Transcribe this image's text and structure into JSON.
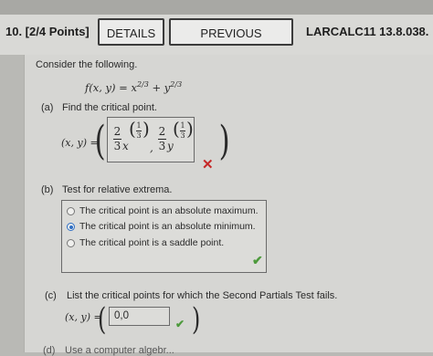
{
  "header": {
    "problem_number": "10.  [2/4 Points]",
    "details_label": "DETAILS",
    "previous_answers_label": "PREVIOUS ANSWERS",
    "problem_id": "LARCALC11 13.8.038."
  },
  "intro": "Consider the following.",
  "function": {
    "lhs": "f(x, y) = x",
    "exp1": "2/3",
    "plus": " + y",
    "exp2": "2/3"
  },
  "part_a": {
    "label": "(a)",
    "prompt": "Find the critical point.",
    "answer_lhs": "(x, y) =",
    "answer_frac_num": "2",
    "answer_frac_den": "3",
    "answer_var1": "x",
    "answer_var2": "y",
    "answer_exp_num": "1",
    "answer_exp_den": "3",
    "comma": ",",
    "status": "incorrect"
  },
  "part_b": {
    "label": "(b)",
    "prompt": "Test for relative extrema.",
    "options": [
      {
        "label": "The critical point is an absolute maximum.",
        "selected": false
      },
      {
        "label": "The critical point is an absolute minimum.",
        "selected": true
      },
      {
        "label": "The critical point is a saddle point.",
        "selected": false
      }
    ],
    "status": "correct"
  },
  "part_c": {
    "label": "(c)",
    "prompt": "List the critical points for which the Second Partials Test fails.",
    "answer_lhs": "(x, y) =",
    "answer_value": "0,0",
    "status": "correct"
  },
  "part_d": {
    "label": "(d)",
    "prompt": "Use a computer algebr..."
  },
  "colors": {
    "wrong": "#c62828",
    "correct": "#4d9a3c",
    "radio_selected": "#2f6fc4"
  }
}
